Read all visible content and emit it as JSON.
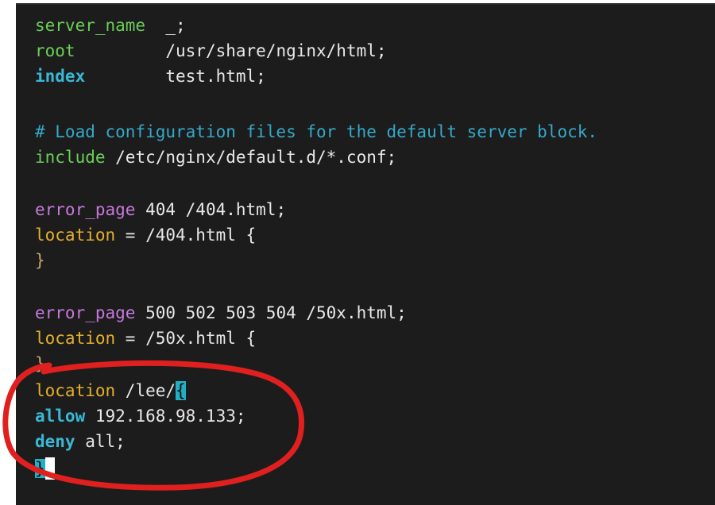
{
  "editor": {
    "lines": [
      {
        "directive": "server_name",
        "pad": "  ",
        "value": "_;"
      },
      {
        "directive": "root",
        "pad": "         ",
        "value": "/usr/share/nginx/html;"
      },
      {
        "directive": "index",
        "pad": "        ",
        "value": "test.html;"
      },
      {
        "comment": "# Load configuration files for the default server block."
      },
      {
        "directive": "include",
        "value": " /etc/nginx/default.d/*.conf;"
      },
      {
        "directive": "error_page",
        "value": " 404 /404.html;"
      },
      {
        "directive": "location",
        "value": " = /404.html {"
      },
      {
        "value": "}"
      },
      {
        "directive": "error_page",
        "value": " 500 502 503 504 /50x.html;"
      },
      {
        "directive": "location",
        "value": " = /50x.html {"
      },
      {
        "value": "}"
      },
      {
        "directive": "location",
        "value": " /lee/",
        "brace": "{"
      },
      {
        "directive": "allow",
        "value": " 192.168.98.133;"
      },
      {
        "directive": "deny",
        "value": " all;"
      },
      {
        "brace": "}"
      }
    ]
  },
  "colors": {
    "background": "#1c1c1c",
    "annotation": "#e0201f",
    "highlight": "#1fb0c6"
  },
  "annotation": {
    "shape": "hand-drawn-circle"
  }
}
